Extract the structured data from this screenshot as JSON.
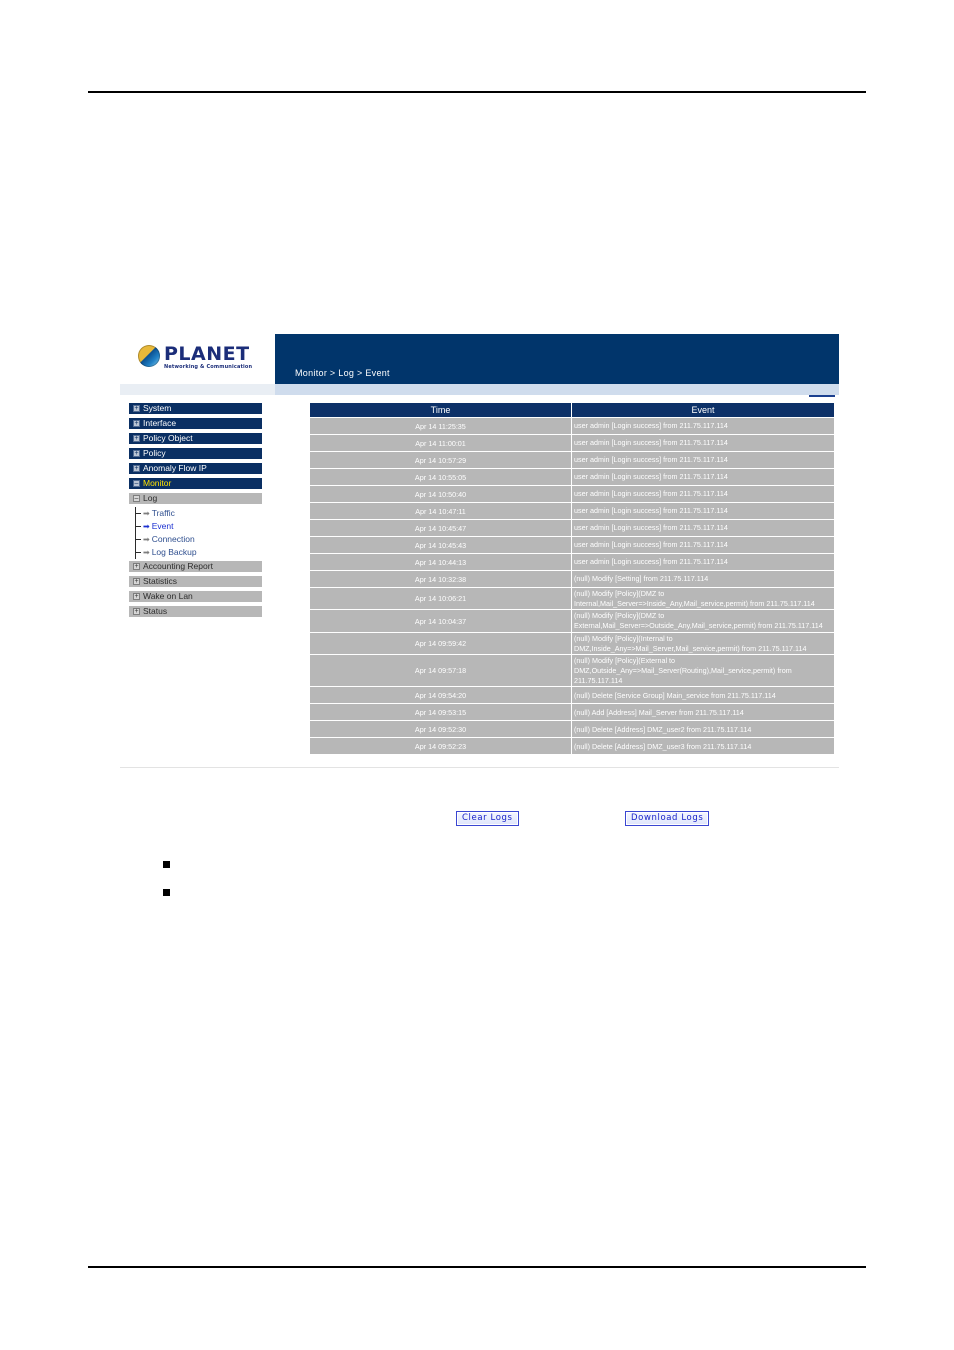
{
  "document": {
    "rule_top": "",
    "rule_bottom": ""
  },
  "logo": {
    "word": "PLANET",
    "tagline": "Networking & Communication",
    "globe_icon": "planet-globe-icon"
  },
  "header": {
    "breadcrumb": "Monitor > Log > Event",
    "bg_color": "#01356b"
  },
  "sidebar": {
    "top_items": [
      {
        "label": "System",
        "state": "collapsed",
        "icon": "plus-box-icon"
      },
      {
        "label": "Interface",
        "state": "collapsed",
        "icon": "plus-box-icon"
      },
      {
        "label": "Policy Object",
        "state": "collapsed",
        "icon": "plus-box-icon"
      },
      {
        "label": "Policy",
        "state": "collapsed",
        "icon": "plus-box-icon"
      },
      {
        "label": "Anomaly Flow IP",
        "state": "collapsed",
        "icon": "plus-box-icon"
      },
      {
        "label": "Monitor",
        "state": "expanded",
        "icon": "minus-box-icon",
        "active": true
      }
    ],
    "group": {
      "label": "Log",
      "icon": "minus-box-icon"
    },
    "sub_items": [
      {
        "label": "Traffic",
        "selected": false,
        "icon": "arrow-right-icon"
      },
      {
        "label": "Event",
        "selected": true,
        "icon": "arrow-right-icon"
      },
      {
        "label": "Connection",
        "selected": false,
        "icon": "arrow-right-icon"
      },
      {
        "label": "Log Backup",
        "selected": false,
        "icon": "arrow-right-icon"
      }
    ],
    "bottom_items": [
      {
        "label": "Accounting Report",
        "icon": "plus-box-icon"
      },
      {
        "label": "Statistics",
        "icon": "plus-box-icon"
      },
      {
        "label": "Wake on Lan",
        "icon": "plus-box-icon"
      },
      {
        "label": "Status",
        "icon": "plus-box-icon"
      }
    ],
    "active_color": "#ffe200",
    "nav_color": "#0a2f63"
  },
  "log_table": {
    "columns": [
      "Time",
      "Event"
    ],
    "rows": [
      {
        "time": "Apr 14 11:25:35",
        "event": "user admin [Login success] from 211.75.117.114"
      },
      {
        "time": "Apr 14 11:00:01",
        "event": "user admin [Login success] from 211.75.117.114"
      },
      {
        "time": "Apr 14 10:57:29",
        "event": "user admin [Login success] from 211.75.117.114"
      },
      {
        "time": "Apr 14 10:55:05",
        "event": "user admin [Login success] from 211.75.117.114"
      },
      {
        "time": "Apr 14 10:50:40",
        "event": "user admin [Login success] from 211.75.117.114"
      },
      {
        "time": "Apr 14 10:47:11",
        "event": "user admin [Login success] from 211.75.117.114"
      },
      {
        "time": "Apr 14 10:45:47",
        "event": "user admin [Login success] from 211.75.117.114"
      },
      {
        "time": "Apr 14 10:45:43",
        "event": "user admin [Login success] from 211.75.117.114"
      },
      {
        "time": "Apr 14 10:44:13",
        "event": "user admin [Login success] from 211.75.117.114"
      },
      {
        "time": "Apr 14 10:32:38",
        "event": "(null) Modify [Setting] from 211.75.117.114"
      },
      {
        "time": "Apr 14 10:06:21",
        "event": "(null) Modify [Policy](DMZ to Internal,Mail_Server=>Inside_Any,Mail_service,permit) from 211.75.117.114"
      },
      {
        "time": "Apr 14 10:04:37",
        "event": "(null) Modify [Policy](DMZ to External,Mail_Server=>Outside_Any,Mail_service,permit) from 211.75.117.114"
      },
      {
        "time": "Apr 14 09:59:42",
        "event": "(null) Modify [Policy](Internal to DMZ,Inside_Any=>Mail_Server,Mail_service,permit) from 211.75.117.114"
      },
      {
        "time": "Apr 14 09:57:18",
        "event": "(null) Modify [Policy](External to DMZ,Outside_Any=>Mail_Server(Routing),Mail_service,permit) from 211.75.117.114"
      },
      {
        "time": "Apr 14 09:54:20",
        "event": "(null) Delete [Service Group] Main_service from 211.75.117.114"
      },
      {
        "time": "Apr 14 09:53:15",
        "event": "(null) Add [Address] Mail_Server from 211.75.117.114"
      },
      {
        "time": "Apr 14 09:52:30",
        "event": "(null) Delete [Address] DMZ_user2 from 211.75.117.114"
      },
      {
        "time": "Apr 14 09:52:23",
        "event": "(null) Delete [Address] DMZ_user3 from 211.75.117.114"
      }
    ]
  },
  "buttons": {
    "clear_logs": "Clear Logs",
    "download_logs": "Download Logs",
    "color": "#1a23c8"
  },
  "bullets": [
    {
      "text": ""
    },
    {
      "text": ""
    }
  ]
}
